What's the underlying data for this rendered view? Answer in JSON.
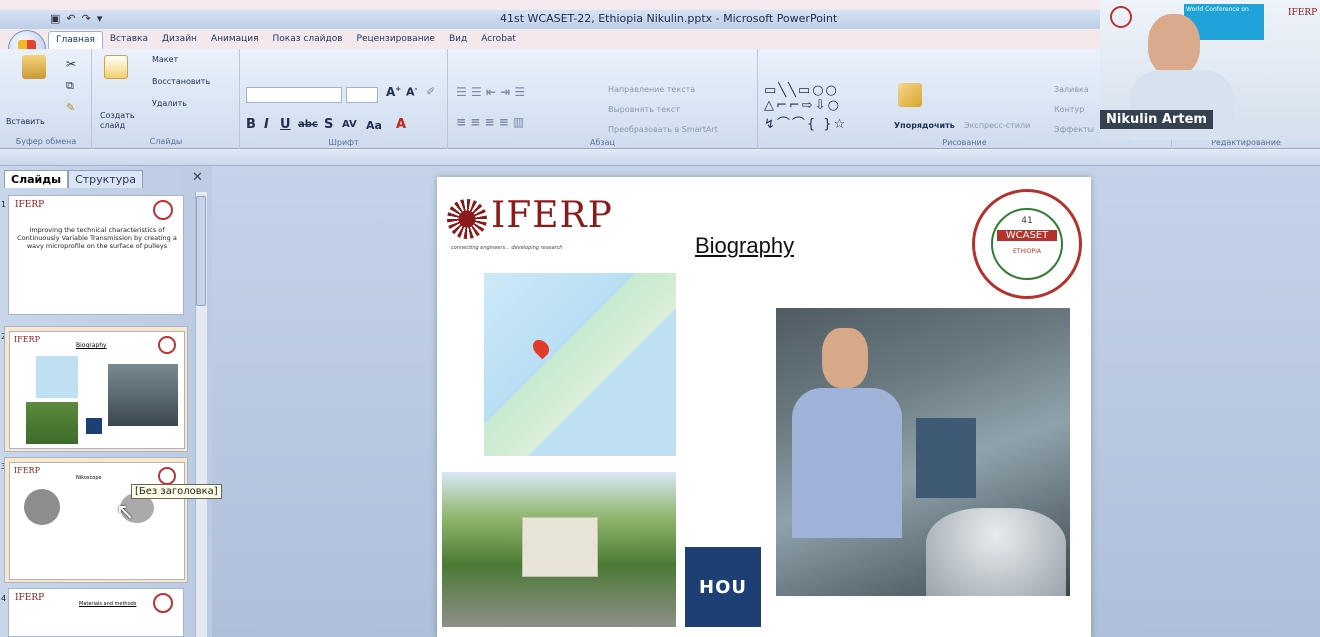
{
  "window": {
    "title": "41st WCASET-22, Ethiopia Nikulin.pptx - Microsoft PowerPoint"
  },
  "ribbon_tabs": [
    "Главная",
    "Вставка",
    "Дизайн",
    "Анимация",
    "Показ слайдов",
    "Рецензирование",
    "Вид",
    "Acrobat"
  ],
  "clipboard": {
    "paste": "Вставить",
    "group": "Буфер обмена"
  },
  "slides_group": {
    "create": "Создать слайд",
    "layout": "Макет",
    "reset": "Восстановить",
    "delete": "Удалить",
    "group": "Слайды"
  },
  "font_group": {
    "group": "Шрифт"
  },
  "paragraph_group": {
    "text_dir": "Направление текста",
    "align_text": "Выровнять текст",
    "smartart": "Преобразовать в SmartArt",
    "group": "Абзац"
  },
  "drawing_group": {
    "arrange": "Упорядочить",
    "quick_styles": "Экспресс-стили",
    "fill": "Заливка",
    "outline": "Контур",
    "effects": "Эффекты",
    "group": "Рисование"
  },
  "editing_group": {
    "group": "Редактирование"
  },
  "panel_tabs": {
    "slides": "Слайды",
    "outline": "Структура"
  },
  "thumbnails": [
    {
      "num": "1",
      "logo": "IFERP",
      "title": "Improving the technical characteristics of Continuously Variable Transmission by creating a wavy microprofile on the surface of pulleys"
    },
    {
      "num": "2",
      "logo": "IFERP",
      "title": "Biography"
    },
    {
      "num": "3",
      "logo": "IFERP",
      "title": "Nikoscope"
    },
    {
      "num": "4",
      "logo": "IFERP",
      "title": "Materials and methods"
    }
  ],
  "tooltip": "[Без заголовка]",
  "slide": {
    "logo": "IFERP",
    "logo_tag": "connecting engineers... developing research",
    "heading": "Biography",
    "badge_top": "41",
    "badge_mid": "WCASET",
    "badge_bottom": "ETHIOPIA",
    "hou_logo": "HOU"
  },
  "webcam": {
    "name": "Nikulin Artem",
    "banner": "World Conference on",
    "brand": "IFERP"
  },
  "colors": {
    "accent": "#1c3a66",
    "iferp_red": "#8b1a1a",
    "hou_blue": "#1e3f73"
  }
}
